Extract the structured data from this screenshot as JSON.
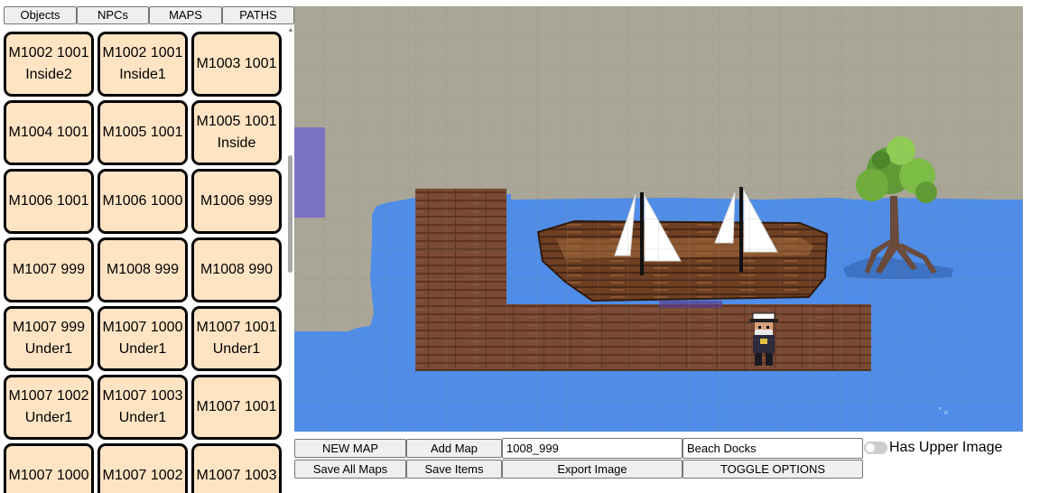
{
  "tabs": [
    {
      "label": "Objects"
    },
    {
      "label": "NPCs"
    },
    {
      "label": "MAPS"
    },
    {
      "label": "PATHS"
    }
  ],
  "map_list": [
    {
      "label": "M1002 1001\nInside2"
    },
    {
      "label": "M1002 1001\nInside1"
    },
    {
      "label": "M1003 1001"
    },
    {
      "label": "M1004 1001"
    },
    {
      "label": "M1005 1001"
    },
    {
      "label": "M1005 1001\nInside"
    },
    {
      "label": "M1006 1001"
    },
    {
      "label": "M1006 1000"
    },
    {
      "label": "M1006 999"
    },
    {
      "label": "M1007 999"
    },
    {
      "label": "M1008 999"
    },
    {
      "label": "M1008 990"
    },
    {
      "label": "M1007 999\nUnder1"
    },
    {
      "label": "M1007 1000\nUnder1"
    },
    {
      "label": "M1007 1001\nUnder1"
    },
    {
      "label": "M1007 1002\nUnder1"
    },
    {
      "label": "M1007 1003\nUnder1"
    },
    {
      "label": "M1007 1001"
    },
    {
      "label": "M1007 1000"
    },
    {
      "label": "M1007 1002"
    },
    {
      "label": "M1007 1003"
    }
  ],
  "toolbar": {
    "new_map_label": "NEW MAP",
    "add_map_label": "Add Map",
    "map_id_value": "1008_999",
    "map_name_value": "Beach Docks",
    "upper_image_label": "Has Upper Image",
    "upper_image_on": false,
    "save_all_label": "Save All Maps",
    "save_items_label": "Save Items",
    "export_label": "Export Image",
    "toggle_options_label": "TOGGLE OPTIONS"
  },
  "icons": {
    "scroll_up": "scroll-up-arrow-icon"
  },
  "colors": {
    "tile_bg": "#ffe4c4",
    "sand": "#a9a597",
    "water": "#4f8de8",
    "dock_wood": "#7a4a33",
    "boat_wood": "#6e3f22",
    "sail": "#ffffff",
    "purple_zone": "#7b72c6",
    "tree_leaf": "#6fae3c"
  }
}
